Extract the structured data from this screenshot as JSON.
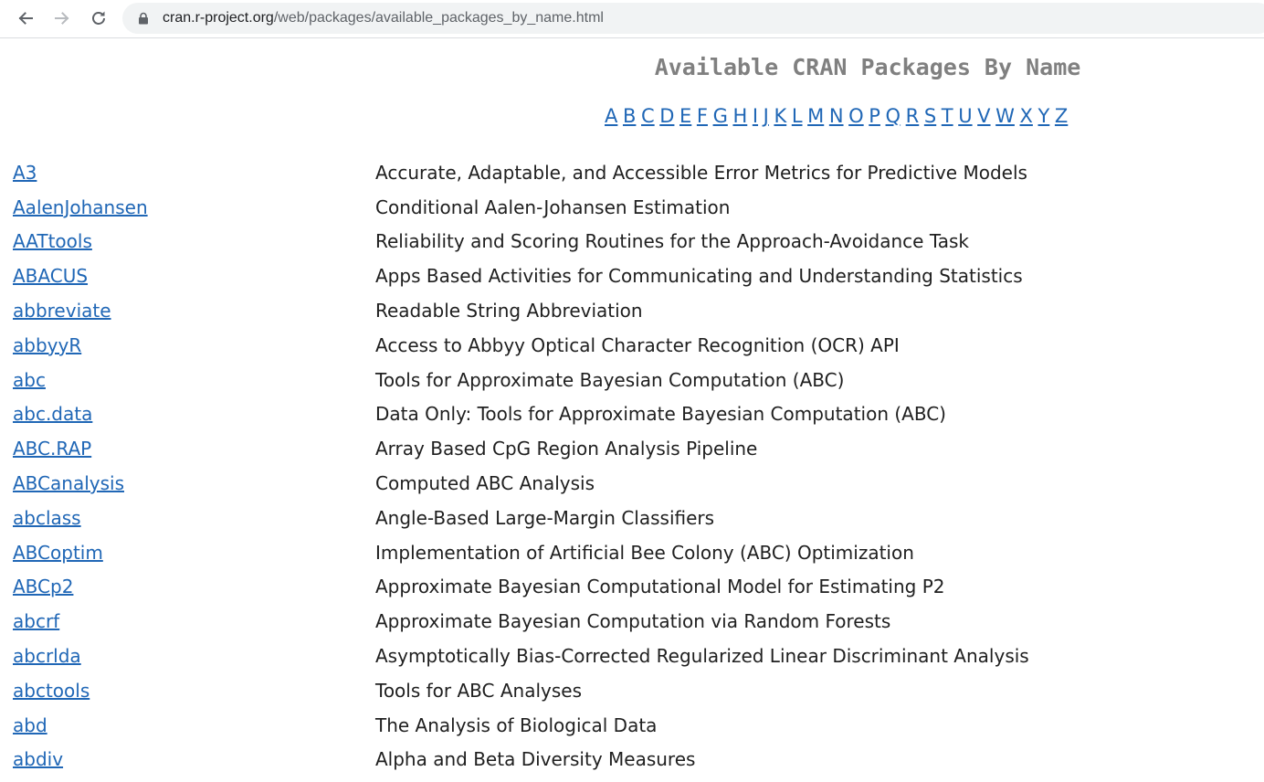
{
  "browser": {
    "url_host": "cran.r-project.org",
    "url_path": "/web/packages/available_packages_by_name.html"
  },
  "page": {
    "title": "Available CRAN Packages By Name",
    "letters": [
      "A",
      "B",
      "C",
      "D",
      "E",
      "F",
      "G",
      "H",
      "I",
      "J",
      "K",
      "L",
      "M",
      "N",
      "O",
      "P",
      "Q",
      "R",
      "S",
      "T",
      "U",
      "V",
      "W",
      "X",
      "Y",
      "Z"
    ]
  },
  "packages": [
    {
      "name": "A3",
      "description": "Accurate, Adaptable, and Accessible Error Metrics for Predictive Models"
    },
    {
      "name": "AalenJohansen",
      "description": "Conditional Aalen-Johansen Estimation"
    },
    {
      "name": "AATtools",
      "description": "Reliability and Scoring Routines for the Approach-Avoidance Task"
    },
    {
      "name": "ABACUS",
      "description": "Apps Based Activities for Communicating and Understanding Statistics"
    },
    {
      "name": "abbreviate",
      "description": "Readable String Abbreviation"
    },
    {
      "name": "abbyyR",
      "description": "Access to Abbyy Optical Character Recognition (OCR) API"
    },
    {
      "name": "abc",
      "description": "Tools for Approximate Bayesian Computation (ABC)"
    },
    {
      "name": "abc.data",
      "description": "Data Only: Tools for Approximate Bayesian Computation (ABC)"
    },
    {
      "name": "ABC.RAP",
      "description": "Array Based CpG Region Analysis Pipeline"
    },
    {
      "name": "ABCanalysis",
      "description": "Computed ABC Analysis"
    },
    {
      "name": "abclass",
      "description": "Angle-Based Large-Margin Classifiers"
    },
    {
      "name": "ABCoptim",
      "description": "Implementation of Artificial Bee Colony (ABC) Optimization"
    },
    {
      "name": "ABCp2",
      "description": "Approximate Bayesian Computational Model for Estimating P2"
    },
    {
      "name": "abcrf",
      "description": "Approximate Bayesian Computation via Random Forests"
    },
    {
      "name": "abcrlda",
      "description": "Asymptotically Bias-Corrected Regularized Linear Discriminant Analysis"
    },
    {
      "name": "abctools",
      "description": "Tools for ABC Analyses"
    },
    {
      "name": "abd",
      "description": "The Analysis of Biological Data"
    },
    {
      "name": "abdiv",
      "description": "Alpha and Beta Diversity Measures"
    }
  ]
}
